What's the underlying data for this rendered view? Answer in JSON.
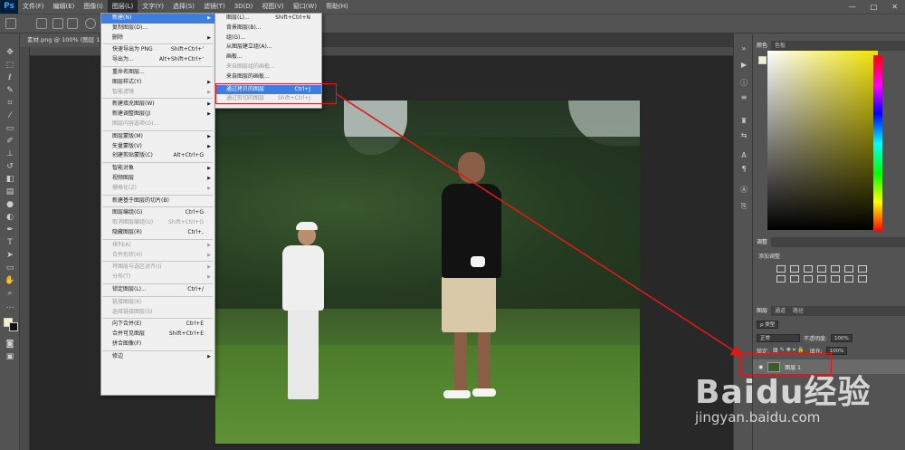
{
  "app": {
    "logo": "Ps"
  },
  "menubar": {
    "items": [
      "文件(F)",
      "编辑(E)",
      "图像(I)",
      "图层(L)",
      "文字(Y)",
      "选择(S)",
      "滤镜(T)",
      "3D(D)",
      "视图(V)",
      "窗口(W)",
      "帮助(H)"
    ],
    "active_index": 3,
    "window_controls": [
      "—",
      "□",
      "✕"
    ]
  },
  "document": {
    "tab_title": "素材.png @ 100% (图层 1, R"
  },
  "layer_menu": {
    "items": [
      {
        "label": "新建(N)",
        "shortcut": "",
        "submenu": true,
        "disabled": false,
        "highlight": true
      },
      {
        "label": "复制图层(D)...",
        "shortcut": "",
        "submenu": false,
        "disabled": false
      },
      {
        "label": "删除",
        "shortcut": "",
        "submenu": true,
        "disabled": false
      },
      {
        "sep": true
      },
      {
        "label": "快速导出为 PNG",
        "shortcut": "Shift+Ctrl+'",
        "submenu": false,
        "disabled": false
      },
      {
        "label": "导出为...",
        "shortcut": "Alt+Shift+Ctrl+'",
        "submenu": false,
        "disabled": false
      },
      {
        "sep": true
      },
      {
        "label": "重命名图层...",
        "shortcut": "",
        "submenu": false,
        "disabled": false
      },
      {
        "label": "图层样式(Y)",
        "shortcut": "",
        "submenu": true,
        "disabled": false
      },
      {
        "label": "智能滤镜",
        "shortcut": "",
        "submenu": true,
        "disabled": true
      },
      {
        "sep": true
      },
      {
        "label": "新建填充图层(W)",
        "shortcut": "",
        "submenu": true,
        "disabled": false
      },
      {
        "label": "新建调整图层(J)",
        "shortcut": "",
        "submenu": true,
        "disabled": false
      },
      {
        "label": "图层内容选项(O)...",
        "shortcut": "",
        "submenu": false,
        "disabled": true
      },
      {
        "sep": true
      },
      {
        "label": "图层蒙版(M)",
        "shortcut": "",
        "submenu": true,
        "disabled": false
      },
      {
        "label": "矢量蒙版(V)",
        "shortcut": "",
        "submenu": true,
        "disabled": false
      },
      {
        "label": "创建剪贴蒙版(C)",
        "shortcut": "Alt+Ctrl+G",
        "submenu": false,
        "disabled": false
      },
      {
        "sep": true
      },
      {
        "label": "智能对象",
        "shortcut": "",
        "submenu": true,
        "disabled": false
      },
      {
        "label": "视频图层",
        "shortcut": "",
        "submenu": true,
        "disabled": false
      },
      {
        "label": "栅格化(Z)",
        "shortcut": "",
        "submenu": true,
        "disabled": true
      },
      {
        "sep": true
      },
      {
        "label": "新建基于图层的切片(B)",
        "shortcut": "",
        "submenu": false,
        "disabled": false
      },
      {
        "sep": true
      },
      {
        "label": "图层编组(G)",
        "shortcut": "Ctrl+G",
        "submenu": false,
        "disabled": false
      },
      {
        "label": "取消图层编组(U)",
        "shortcut": "Shift+Ctrl+G",
        "submenu": false,
        "disabled": true
      },
      {
        "label": "隐藏图层(R)",
        "shortcut": "Ctrl+,",
        "submenu": false,
        "disabled": false
      },
      {
        "sep": true
      },
      {
        "label": "排列(A)",
        "shortcut": "",
        "submenu": true,
        "disabled": true
      },
      {
        "label": "合并形状(H)",
        "shortcut": "",
        "submenu": true,
        "disabled": true
      },
      {
        "sep": true
      },
      {
        "label": "将图层与选区对齐(I)",
        "shortcut": "",
        "submenu": true,
        "disabled": true
      },
      {
        "label": "分布(T)",
        "shortcut": "",
        "submenu": true,
        "disabled": true
      },
      {
        "sep": true
      },
      {
        "label": "锁定图层(L)...",
        "shortcut": "Ctrl+/",
        "submenu": false,
        "disabled": false
      },
      {
        "sep": true
      },
      {
        "label": "链接图层(K)",
        "shortcut": "",
        "submenu": false,
        "disabled": true
      },
      {
        "label": "选择链接图层(S)",
        "shortcut": "",
        "submenu": false,
        "disabled": true
      },
      {
        "sep": true
      },
      {
        "label": "向下合并(E)",
        "shortcut": "Ctrl+E",
        "submenu": false,
        "disabled": false
      },
      {
        "label": "合并可见图层",
        "shortcut": "Shift+Ctrl+E",
        "submenu": false,
        "disabled": false
      },
      {
        "label": "拼合图像(F)",
        "shortcut": "",
        "submenu": false,
        "disabled": false
      },
      {
        "sep": true
      },
      {
        "label": "修边",
        "shortcut": "",
        "submenu": true,
        "disabled": false
      }
    ]
  },
  "new_submenu": {
    "items": [
      {
        "label": "图层(L)...",
        "shortcut": "Shift+Ctrl+N",
        "disabled": false
      },
      {
        "label": "背景图层(B)...",
        "shortcut": "",
        "disabled": false
      },
      {
        "label": "组(G)...",
        "shortcut": "",
        "disabled": false
      },
      {
        "label": "从图层建立组(A)...",
        "shortcut": "",
        "disabled": false
      },
      {
        "label": "画板...",
        "shortcut": "",
        "disabled": false
      },
      {
        "label": "来自图层组的画板...",
        "shortcut": "",
        "disabled": true
      },
      {
        "label": "来自图层的画板...",
        "shortcut": "",
        "disabled": false
      },
      {
        "sep": true
      },
      {
        "label": "通过拷贝的图层",
        "shortcut": "Ctrl+J",
        "disabled": false,
        "highlight": true
      },
      {
        "label": "通过剪切的图层",
        "shortcut": "Shift+Ctrl+J",
        "disabled": true
      }
    ]
  },
  "panels": {
    "color_tabs": [
      "颜色",
      "色板"
    ],
    "adjust_tab": "调整",
    "adjust_add": "添加调整",
    "layer_tabs": [
      "图层",
      "通道",
      "路径"
    ],
    "kind_label": "ρ 类型",
    "blend_mode": "正常",
    "opacity_label": "不透明度:",
    "opacity_value": "100%",
    "lock_label": "锁定:",
    "fill_label": "填充:",
    "fill_value": "100%",
    "layer_name": "图层 1"
  },
  "watermark": {
    "logo": "Baidu经验",
    "url": "jingyan.baidu.com"
  },
  "colors": {
    "menubar": "#535353",
    "highlight": "#3d7ee0",
    "annotation": "#e01818"
  }
}
